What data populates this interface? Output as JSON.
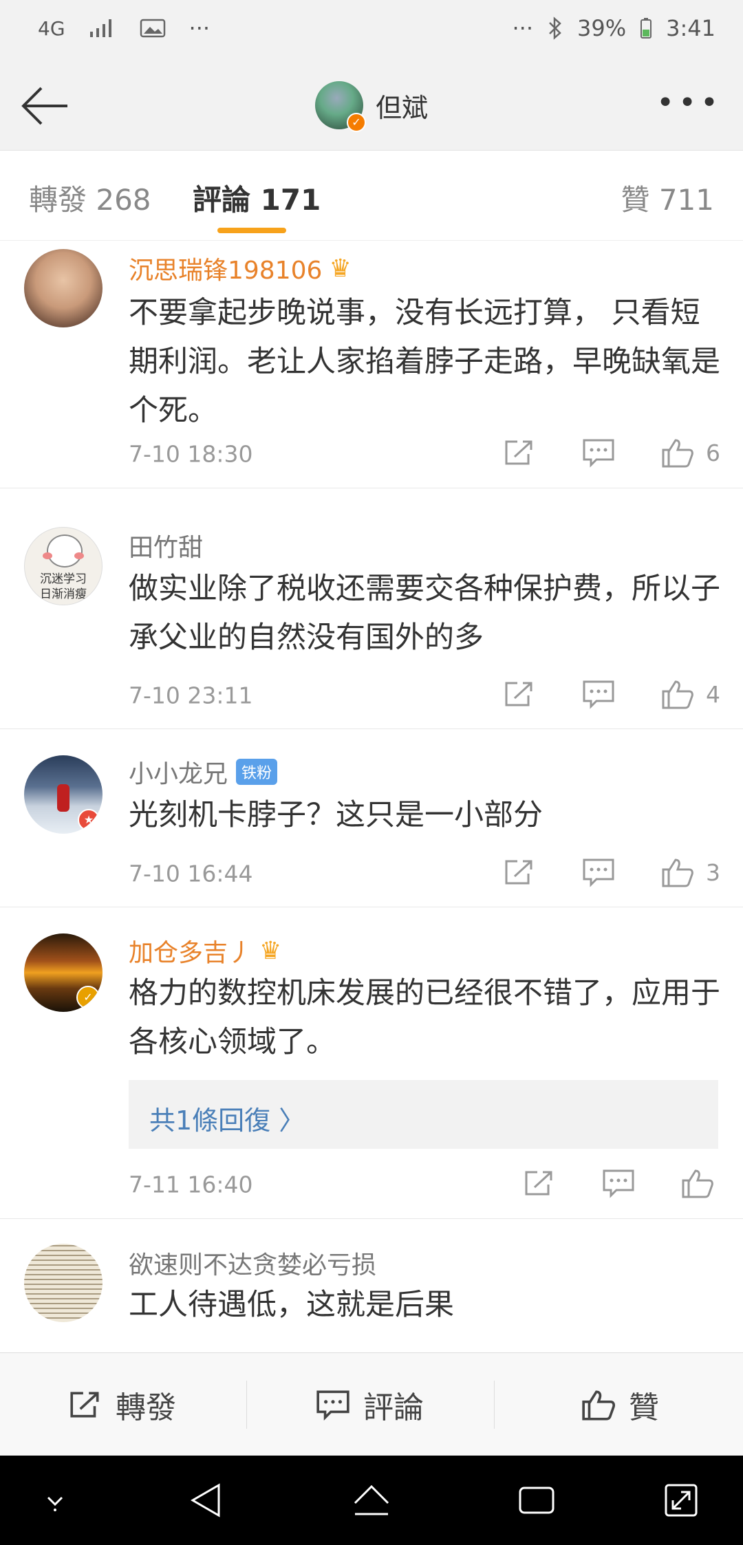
{
  "status_bar": {
    "network": "4G",
    "dots_left": "···",
    "dots_right": "···",
    "battery": "39%",
    "time": "3:41"
  },
  "header": {
    "title": "但斌"
  },
  "tabs": {
    "repost": "轉發 268",
    "comments": "評論 171",
    "likes": "贊 711"
  },
  "comments": [
    {
      "name": "沉思瑞锋198106",
      "text": "不要拿起步晚说事，没有长远打算， 只看短期利润。老让人家掐着脖子走路，早晚缺氧是个死。",
      "time": "7-10 18:30",
      "likes": "6"
    },
    {
      "name": "田竹甜",
      "avatar_text_1": "沉迷学习",
      "avatar_text_2": "日渐消瘦",
      "text": "做实业除了税收还需要交各种保护费，所以子承父业的自然没有国外的多",
      "time": "7-10 23:11",
      "likes": "4"
    },
    {
      "name": "小小龙兄",
      "badge": "铁粉",
      "text": "光刻机卡脖子？这只是一小部分",
      "time": "7-10 16:44",
      "likes": "3"
    },
    {
      "name": "加仓多吉丿",
      "text": "格力的数控机床发展的已经很不错了，应用于各核心领域了。",
      "reply": "共1條回復 〉",
      "time": "7-11 16:40",
      "likes": ""
    },
    {
      "name": "欲速则不达贪婪必亏损",
      "text": "工人待遇低，这就是后果"
    }
  ],
  "bottom_bar": {
    "repost": "轉發",
    "comment": "評論",
    "like": "贊"
  },
  "colors": {
    "accent": "#f7a21b",
    "vip_name": "#e8822a",
    "link": "#4a7fb8"
  }
}
